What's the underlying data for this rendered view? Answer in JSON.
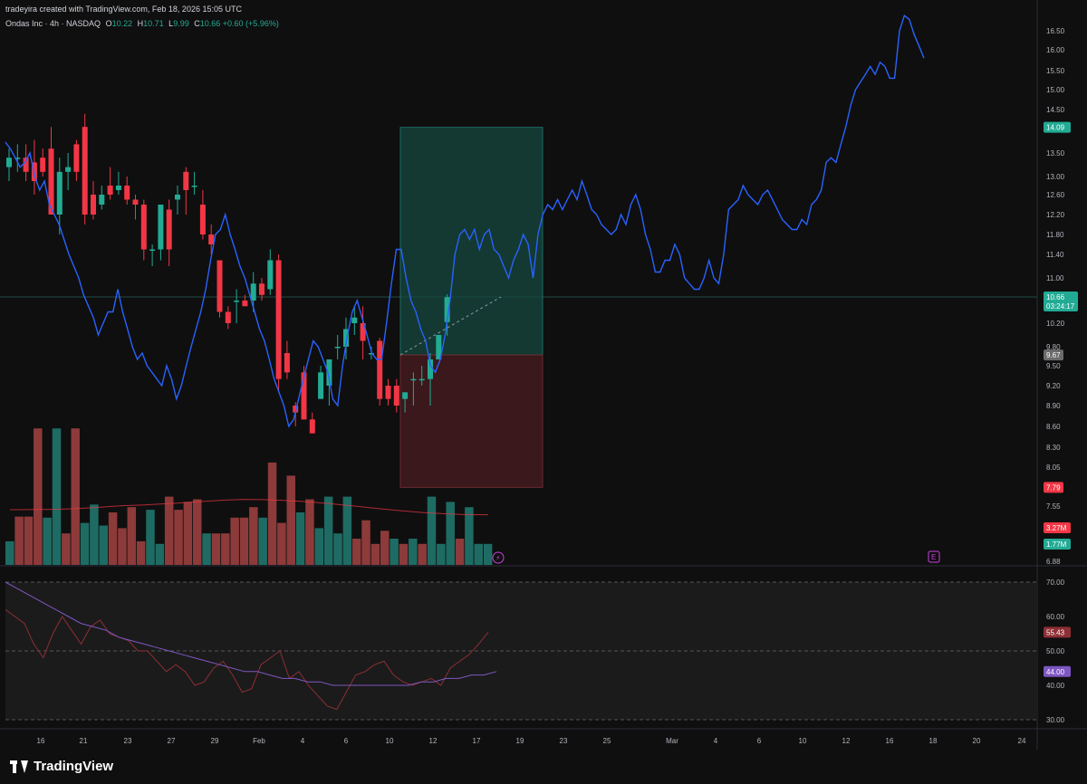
{
  "header": {
    "credit": "tradeyira created with TradingView.com, Feb 18, 2026 15:05 UTC",
    "symbol": "Ondas Inc · 4h · NASDAQ",
    "o_label": "O",
    "o_value": "10.22",
    "h_label": "H",
    "h_value": "10.71",
    "l_label": "L",
    "l_value": "9.99",
    "c_label": "C",
    "c_value": "10.66",
    "change": "+0.60 (+5.96%)"
  },
  "brand": {
    "name": "TradingView"
  },
  "price_tags": {
    "target": "14.09",
    "last": "10.66",
    "countdown": "03:24:17",
    "entry": "9.67",
    "stop": "7.79",
    "vol_ma": "3.27M",
    "vol": "1.77M",
    "rsi": "55.43",
    "rsi_ma": "44.00"
  },
  "colors": {
    "bg": "#0f0f0f",
    "up": "#22ab94",
    "down": "#f23645",
    "projection": "#2962ff",
    "rsi": "#7e57c2",
    "volume_up": "#1e6b63",
    "volume_down": "#8d3a3a"
  },
  "event_icon": "earnings-icon",
  "chart_data": {
    "type": "candlestick",
    "symbol": "Ondas Inc",
    "interval": "4h",
    "exchange": "NASDAQ",
    "x_ticks": [
      "16",
      "21",
      "23",
      "27",
      "29",
      "Feb",
      "4",
      "6",
      "10",
      "12",
      "17",
      "19",
      "23",
      "25",
      "Mar",
      "4",
      "6",
      "10",
      "12",
      "16",
      "18",
      "20",
      "24"
    ],
    "y_ticks": [
      "16.50",
      "16.00",
      "15.50",
      "15.00",
      "14.50",
      "13.50",
      "13.00",
      "12.60",
      "12.20",
      "11.80",
      "11.40",
      "11.00",
      "10.20",
      "9.80",
      "9.50",
      "9.20",
      "8.90",
      "8.60",
      "8.30",
      "8.05",
      "7.55",
      "6.88"
    ],
    "ylim": [
      6.88,
      16.95
    ],
    "candles": [
      {
        "o": 13.2,
        "h": 13.6,
        "l": 12.9,
        "c": 13.4
      },
      {
        "o": 13.4,
        "h": 13.7,
        "l": 13.1,
        "c": 13.4
      },
      {
        "o": 13.4,
        "h": 13.7,
        "l": 12.9,
        "c": 13.1
      },
      {
        "o": 13.3,
        "h": 13.8,
        "l": 12.6,
        "c": 12.9
      },
      {
        "o": 13.4,
        "h": 13.6,
        "l": 13.0,
        "c": 13.1
      },
      {
        "o": 13.6,
        "h": 14.1,
        "l": 12.2,
        "c": 12.2
      },
      {
        "o": 12.2,
        "h": 13.4,
        "l": 11.8,
        "c": 13.1
      },
      {
        "o": 13.1,
        "h": 13.5,
        "l": 12.7,
        "c": 13.2
      },
      {
        "o": 13.7,
        "h": 13.8,
        "l": 12.9,
        "c": 13.1
      },
      {
        "o": 14.1,
        "h": 14.4,
        "l": 12.0,
        "c": 12.2
      },
      {
        "o": 12.6,
        "h": 12.9,
        "l": 12.1,
        "c": 12.2
      },
      {
        "o": 12.4,
        "h": 12.8,
        "l": 12.3,
        "c": 12.6
      },
      {
        "o": 12.8,
        "h": 13.2,
        "l": 12.5,
        "c": 12.6
      },
      {
        "o": 12.7,
        "h": 13.1,
        "l": 12.6,
        "c": 12.8
      },
      {
        "o": 12.8,
        "h": 13.0,
        "l": 12.4,
        "c": 12.5
      },
      {
        "o": 12.5,
        "h": 12.6,
        "l": 12.1,
        "c": 12.4
      },
      {
        "o": 12.4,
        "h": 12.5,
        "l": 11.3,
        "c": 11.5
      },
      {
        "o": 11.5,
        "h": 11.6,
        "l": 11.2,
        "c": 11.5
      },
      {
        "o": 11.5,
        "h": 12.2,
        "l": 11.3,
        "c": 12.4
      },
      {
        "o": 12.3,
        "h": 12.5,
        "l": 11.2,
        "c": 11.5
      },
      {
        "o": 12.5,
        "h": 12.8,
        "l": 12.2,
        "c": 12.6
      },
      {
        "o": 13.1,
        "h": 13.2,
        "l": 12.2,
        "c": 12.7
      },
      {
        "o": 12.8,
        "h": 13.1,
        "l": 12.6,
        "c": 12.8
      },
      {
        "o": 12.4,
        "h": 12.7,
        "l": 11.7,
        "c": 11.8
      },
      {
        "o": 11.8,
        "h": 12.0,
        "l": 11.4,
        "c": 11.6
      },
      {
        "o": 11.3,
        "h": 11.3,
        "l": 10.3,
        "c": 10.4
      },
      {
        "o": 10.4,
        "h": 10.5,
        "l": 10.1,
        "c": 10.2
      },
      {
        "o": 10.6,
        "h": 10.8,
        "l": 10.2,
        "c": 10.6
      },
      {
        "o": 10.6,
        "h": 10.7,
        "l": 10.5,
        "c": 10.5
      },
      {
        "o": 10.6,
        "h": 11.1,
        "l": 10.4,
        "c": 10.9
      },
      {
        "o": 10.9,
        "h": 11.0,
        "l": 10.6,
        "c": 10.7
      },
      {
        "o": 10.8,
        "h": 11.5,
        "l": 10.7,
        "c": 11.3
      },
      {
        "o": 11.3,
        "h": 11.4,
        "l": 9.1,
        "c": 9.3
      },
      {
        "o": 9.7,
        "h": 9.9,
        "l": 9.3,
        "c": 9.4
      },
      {
        "o": 8.9,
        "h": 8.95,
        "l": 8.6,
        "c": 8.8
      },
      {
        "o": 9.4,
        "h": 9.5,
        "l": 8.7,
        "c": 8.7
      },
      {
        "o": 8.7,
        "h": 8.8,
        "l": 8.5,
        "c": 8.5
      },
      {
        "o": 9.0,
        "h": 9.5,
        "l": 9.0,
        "c": 9.4
      },
      {
        "o": 9.2,
        "h": 9.6,
        "l": 8.9,
        "c": 9.6
      },
      {
        "o": 9.8,
        "h": 10.0,
        "l": 9.6,
        "c": 9.8
      },
      {
        "o": 9.8,
        "h": 10.3,
        "l": 9.6,
        "c": 10.1
      },
      {
        "o": 10.2,
        "h": 10.5,
        "l": 10.0,
        "c": 10.3
      },
      {
        "o": 10.2,
        "h": 10.5,
        "l": 9.6,
        "c": 9.9
      },
      {
        "o": 9.7,
        "h": 9.8,
        "l": 9.6,
        "c": 9.7
      },
      {
        "o": 9.9,
        "h": 9.95,
        "l": 8.9,
        "c": 9.0
      },
      {
        "o": 9.2,
        "h": 9.3,
        "l": 8.9,
        "c": 9.0
      },
      {
        "o": 9.2,
        "h": 9.3,
        "l": 8.8,
        "c": 8.9
      },
      {
        "o": 9.0,
        "h": 9.1,
        "l": 8.8,
        "c": 9.1
      },
      {
        "o": 9.3,
        "h": 9.4,
        "l": 8.9,
        "c": 9.3
      },
      {
        "o": 9.3,
        "h": 9.5,
        "l": 9.2,
        "c": 9.3
      },
      {
        "o": 9.3,
        "h": 9.7,
        "l": 8.9,
        "c": 9.6
      },
      {
        "o": 9.6,
        "h": 10.0,
        "l": 9.6,
        "c": 10.0
      },
      {
        "o": 10.22,
        "h": 10.71,
        "l": 9.99,
        "c": 10.66
      }
    ],
    "volume": [
      {
        "v": 0.45,
        "up": true
      },
      {
        "v": 0.92,
        "up": false
      },
      {
        "v": 0.92,
        "up": false
      },
      {
        "v": 2.6,
        "up": false
      },
      {
        "v": 0.9,
        "up": true
      },
      {
        "v": 2.6,
        "up": true
      },
      {
        "v": 0.6,
        "up": false
      },
      {
        "v": 2.6,
        "up": false
      },
      {
        "v": 0.8,
        "up": true
      },
      {
        "v": 1.15,
        "up": true
      },
      {
        "v": 0.75,
        "up": true
      },
      {
        "v": 1.0,
        "up": false
      },
      {
        "v": 0.7,
        "up": false
      },
      {
        "v": 1.1,
        "up": false
      },
      {
        "v": 0.45,
        "up": false
      },
      {
        "v": 1.05,
        "up": true
      },
      {
        "v": 0.4,
        "up": true
      },
      {
        "v": 1.3,
        "up": false
      },
      {
        "v": 1.05,
        "up": false
      },
      {
        "v": 1.2,
        "up": false
      },
      {
        "v": 1.25,
        "up": false
      },
      {
        "v": 0.6,
        "up": true
      },
      {
        "v": 0.6,
        "up": false
      },
      {
        "v": 0.6,
        "up": false
      },
      {
        "v": 0.9,
        "up": false
      },
      {
        "v": 0.9,
        "up": false
      },
      {
        "v": 1.1,
        "up": false
      },
      {
        "v": 0.9,
        "up": true
      },
      {
        "v": 1.95,
        "up": false
      },
      {
        "v": 0.8,
        "up": false
      },
      {
        "v": 1.7,
        "up": false
      },
      {
        "v": 1.0,
        "up": true
      },
      {
        "v": 1.25,
        "up": false
      },
      {
        "v": 0.7,
        "up": true
      },
      {
        "v": 1.3,
        "up": true
      },
      {
        "v": 0.6,
        "up": true
      },
      {
        "v": 1.3,
        "up": true
      },
      {
        "v": 0.5,
        "up": false
      },
      {
        "v": 0.85,
        "up": false
      },
      {
        "v": 0.4,
        "up": false
      },
      {
        "v": 0.65,
        "up": false
      },
      {
        "v": 0.5,
        "up": true
      },
      {
        "v": 0.4,
        "up": false
      },
      {
        "v": 0.5,
        "up": true
      },
      {
        "v": 0.4,
        "up": false
      },
      {
        "v": 1.3,
        "up": true
      },
      {
        "v": 0.4,
        "up": true
      },
      {
        "v": 1.2,
        "up": true
      },
      {
        "v": 0.5,
        "up": false
      },
      {
        "v": 1.1,
        "up": true
      },
      {
        "v": 0.4,
        "up": true
      },
      {
        "v": 0.4,
        "up": true
      }
    ],
    "volume_ma_label": "3.27M",
    "position": {
      "type": "long",
      "entry": 9.67,
      "target": 14.09,
      "stop": 7.79
    },
    "projection": [
      13.75,
      13.6,
      13.4,
      13.2,
      13.3,
      13.5,
      13.0,
      12.7,
      12.9,
      12.4,
      12.2,
      12.0,
      11.7,
      11.4,
      11.2,
      11.0,
      10.7,
      10.5,
      10.3,
      10.0,
      10.2,
      10.4,
      10.4,
      10.8,
      10.4,
      10.1,
      9.8,
      9.6,
      9.7,
      9.5,
      9.4,
      9.3,
      9.2,
      9.5,
      9.3,
      9.0,
      9.2,
      9.5,
      9.8,
      10.1,
      10.4,
      10.8,
      11.3,
      11.8,
      11.9,
      12.2,
      11.8,
      11.5,
      11.2,
      11.0,
      10.7,
      10.4,
      10.1,
      9.9,
      9.6,
      9.3,
      9.1,
      8.9,
      8.6,
      8.7,
      9.0,
      9.3,
      9.6,
      9.9,
      9.8,
      9.6,
      9.4,
      9.0,
      8.9,
      9.5,
      10.0,
      10.4,
      10.6,
      10.3,
      10.0,
      9.7,
      9.6,
      9.6,
      10.2,
      10.9,
      11.5,
      11.5,
      11.0,
      10.6,
      10.4,
      10.1,
      9.9,
      9.5,
      9.4,
      9.6,
      10.0,
      10.6,
      11.4,
      11.8,
      11.9,
      11.7,
      11.9,
      11.5,
      11.8,
      11.9,
      11.5,
      11.4,
      11.2,
      11.0,
      11.3,
      11.5,
      11.8,
      11.6,
      11.0,
      11.8,
      12.2,
      12.4,
      12.3,
      12.5,
      12.3,
      12.5,
      12.7,
      12.5,
      12.9,
      12.6,
      12.3,
      12.2,
      12.0,
      11.9,
      11.8,
      11.9,
      12.2,
      12.0,
      12.4,
      12.6,
      12.3,
      11.8,
      11.5,
      11.1,
      11.1,
      11.3,
      11.3,
      11.6,
      11.4,
      11.0,
      10.9,
      10.8,
      10.8,
      11.0,
      11.3,
      11.0,
      10.9,
      11.4,
      12.3,
      12.4,
      12.5,
      12.8,
      12.6,
      12.5,
      12.4,
      12.6,
      12.7,
      12.5,
      12.3,
      12.1,
      12.0,
      11.9,
      11.9,
      12.1,
      12.0,
      12.4,
      12.5,
      12.7,
      13.3,
      13.4,
      13.3,
      13.7,
      14.1,
      14.6,
      15.0,
      15.2,
      15.4,
      15.6,
      15.4,
      15.7,
      15.6,
      15.3,
      15.3,
      16.5,
      16.9,
      16.8,
      16.4,
      16.1,
      15.8
    ]
  },
  "rsi_data": {
    "y_ticks": [
      "70.00",
      "60.00",
      "50.00",
      "40.00",
      "30.00"
    ],
    "ylim": [
      28,
      73
    ],
    "rsi": [
      62,
      60,
      58,
      52,
      48,
      55,
      60,
      56,
      52,
      57,
      59,
      55,
      54,
      53,
      50,
      50,
      47,
      44,
      46,
      44,
      40,
      41,
      45,
      47,
      43,
      38,
      39,
      46,
      48,
      50,
      42,
      44,
      40,
      37,
      34,
      33,
      38,
      43,
      44,
      46,
      47,
      43,
      41,
      40,
      41,
      42,
      40,
      45,
      47,
      49,
      52,
      55.43
    ],
    "rsi_ma": [
      70,
      68,
      66,
      64,
      62,
      60,
      58,
      57,
      56,
      54,
      53,
      52,
      51,
      50,
      49,
      48,
      47,
      46,
      45,
      44,
      44,
      43,
      42,
      42,
      41,
      41,
      40,
      40,
      40,
      40,
      40,
      40,
      40,
      41,
      41,
      42,
      42,
      43,
      43,
      44.0
    ]
  }
}
